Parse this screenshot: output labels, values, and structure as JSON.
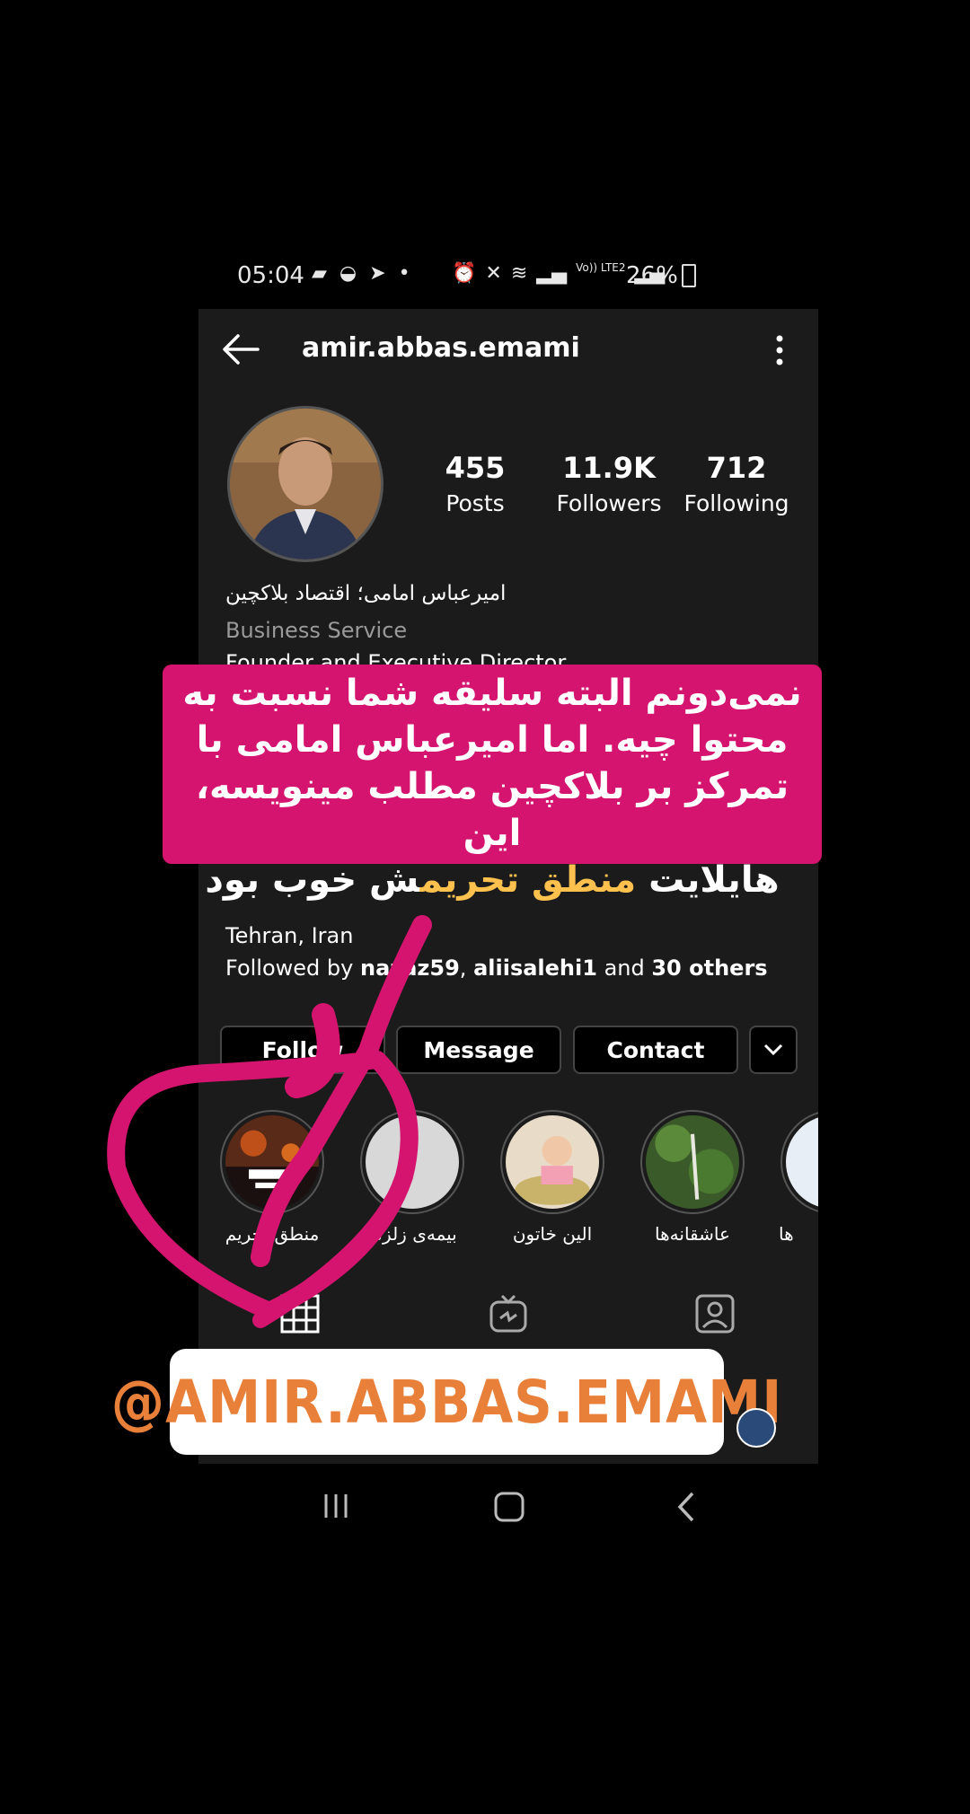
{
  "status_bar": {
    "time": "05:04",
    "network": "Vo)) LTE2",
    "battery": "26%"
  },
  "header": {
    "username": "amir.abbas.emami"
  },
  "stats": [
    {
      "value": "455",
      "label": "Posts"
    },
    {
      "value": "11.9K",
      "label": "Followers"
    },
    {
      "value": "712",
      "label": "Following"
    }
  ],
  "bio": {
    "name": "امیرعباس امامی؛ اقتصاد بلاکچین",
    "category": "Business Service",
    "role": "Founder and Executive Director",
    "location": "Tehran, Iran",
    "followed_by_prefix": "Followed by ",
    "followed_by_user1": "nazaz59",
    "followed_by_sep": ", ",
    "followed_by_user2": "aliisalehi1",
    "followed_by_and": " and ",
    "followed_by_others": "30 others"
  },
  "buttons": {
    "follow": "Follow",
    "message": "Message",
    "contact": "Contact"
  },
  "highlights": [
    {
      "label": "منطق تحریم",
      "color": "#3a2a2a"
    },
    {
      "label": "بیمه‌ی زلزله",
      "color": "#d8d8d8"
    },
    {
      "label": "الین خاتون",
      "color": "#c9b36a"
    },
    {
      "label": "عاشقانه‌ها",
      "color": "#4a6a3a"
    },
    {
      "label": "ها",
      "color": "#e8eef5"
    }
  ],
  "overlay": {
    "line1": "نمی‌دونم البته سلیقه شما نسبت به",
    "line2": "محتوا چیه. اما امیرعباس امامی با",
    "line3": "تمرکز بر بلاکچین مطلب مینویسه، این",
    "line4_pre": "هایلایت ",
    "line4_hi": "منطق تحریم",
    "line4_post": "ش خوب بود"
  },
  "mention": "@AMIR.ABBAS.EMAMI",
  "colors": {
    "story_pink": "#d4146f",
    "highlight_gold": "#ffc14d",
    "mention_orange": "#e8803a"
  }
}
